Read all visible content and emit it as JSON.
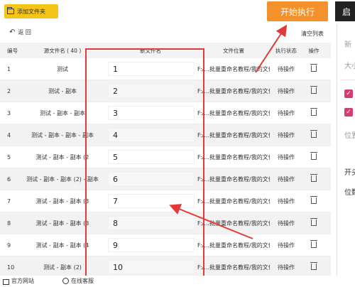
{
  "toolbar": {
    "add_files": "添加文件夹",
    "start": "开始执行",
    "side_button": "启",
    "back": "返 回",
    "clear_list": "清空列表"
  },
  "table": {
    "headers": {
      "no": "编号",
      "src": "源文件名 ( 40 )",
      "new": "新文件名",
      "loc": "文件位置",
      "status": "执行状态",
      "op": "操作"
    },
    "rows": [
      {
        "no": "1",
        "src": "测试",
        "new": "1",
        "loc": "F:/...批量重命名教程/我的文件...",
        "status": "待操作"
      },
      {
        "no": "2",
        "src": "测试 - 副本",
        "new": "2",
        "loc": "F:/...批量重命名教程/我的文件...",
        "status": "待操作"
      },
      {
        "no": "3",
        "src": "测试 - 副本 - 副本",
        "new": "3",
        "loc": "F:/...批量重命名教程/我的文件...",
        "status": "待操作"
      },
      {
        "no": "4",
        "src": "测试 - 副本 - 副本 - 副本",
        "new": "4",
        "loc": "F:/...批量重命名教程/我的文件...",
        "status": "待操作"
      },
      {
        "no": "5",
        "src": "测试 - 副本 - 副本 (2",
        "new": "5",
        "loc": "F:/...批量重命名教程/我的文件...",
        "status": "待操作"
      },
      {
        "no": "6",
        "src": "测试 - 副本 - 副本 (2) - 副本",
        "new": "6",
        "loc": "F:/...批量重命名教程/我的文件...",
        "status": "待操作"
      },
      {
        "no": "7",
        "src": "测试 - 副本 - 副本 (3",
        "new": "7",
        "loc": "F:/...批量重命名教程/我的文件...",
        "status": "待操作"
      },
      {
        "no": "8",
        "src": "测试 - 副本 - 副本 (3",
        "new": "8",
        "loc": "F:/...批量重命名教程/我的文件...",
        "status": "待操作"
      },
      {
        "no": "9",
        "src": "测试 - 副本 - 副本 (4",
        "new": "9",
        "loc": "F:/...批量重命名教程/我的文件...",
        "status": "待操作"
      },
      {
        "no": "10",
        "src": "测试 - 副本 (2)",
        "new": "10",
        "loc": "F:/...批量重命名教程/我的文件...",
        "status": "待操作"
      }
    ]
  },
  "right_panel": {
    "item1": "新",
    "item2": "大小",
    "item3": "位置",
    "item4": "开头",
    "item5": "位数"
  },
  "footer": {
    "website": "官方网站",
    "support": "在线客服"
  },
  "colors": {
    "accent_yellow": "#f5c518",
    "start_orange": "#f5912d",
    "annotation_red": "#e23a3a",
    "checkbox_pink": "#d63d6c"
  }
}
